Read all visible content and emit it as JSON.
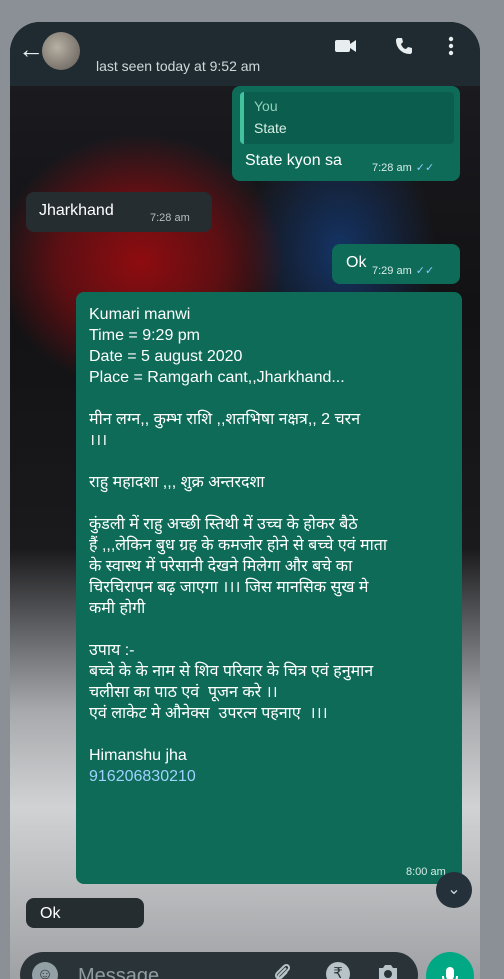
{
  "header": {
    "last_seen": "last seen today at 9:52 am",
    "icons": [
      "back-arrow-icon",
      "video-call-icon",
      "phone-icon",
      "more-icon"
    ]
  },
  "messages": [
    {
      "dir": "out",
      "quote_author": "You",
      "quote_text": "State",
      "text": "State kyon sa",
      "time": "7:28 am",
      "ticks": "✓✓"
    },
    {
      "dir": "in",
      "text": "Jharkhand",
      "time": "7:28 am"
    },
    {
      "dir": "out",
      "text": "Ok",
      "time": "7:29 am",
      "ticks": "✓✓"
    },
    {
      "dir": "out",
      "text": "Kumari manwi\nTime = 9:29 pm\nDate = 5 august 2020\nPlace = Ramgarh cant,,Jharkhand...\n\nमीन लग्न,, कुम्भ राशि ,,शतभिषा नक्षत्र,, 2 चरन\n।।।\n\nराहु महादशा ,,, शुक्र अन्तरदशा\n\nकुंडली में राहु अच्छी स्तिथी में उच्च के होकर बैठे\nहैं ,,,लेकिन बुध ग्रह के कमजोर होने से बच्चे एवं माता\nके स्वास्थ में परेसानी देखने मिलेगा और बचे का\nचिरचिरापन बढ़ जाएगा ।।। जिस मानसिक सुख मे\nकमी होगी\n\nउपाय :-\nबच्चे के के नाम से शिव परिवार के चित्र एवं हनुमान\nचलीसा का पाठ एवं  पूजन करे ।।\nएवं लाकेट मे औनेक्स  उपरत्न पहनाए  ।।।\n\nHimanshu jha",
      "phone": "916206830210",
      "time": "8:00 am"
    },
    {
      "dir": "in",
      "text": "Ok"
    }
  ],
  "input": {
    "placeholder": "Message"
  }
}
